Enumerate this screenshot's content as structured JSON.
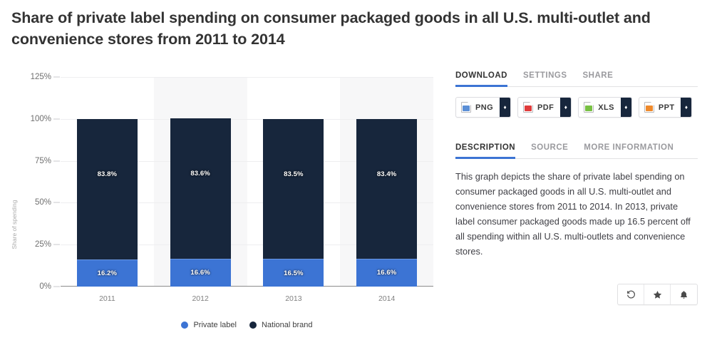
{
  "title": "Share of private label spending on consumer packaged goods in all U.S. multi-outlet and convenience stores from 2011 to 2014",
  "chart_data": {
    "type": "bar",
    "subtype": "stacked-100-percent",
    "title": "Share of private label spending on consumer packaged goods in all U.S. multi-outlet and convenience stores from 2011 to 2014",
    "xlabel": "",
    "ylabel": "Share of spending",
    "categories": [
      "2011",
      "2012",
      "2013",
      "2014"
    ],
    "series": [
      {
        "name": "Private label",
        "color": "#3c74d4",
        "values": [
          16.2,
          16.6,
          16.5,
          16.6
        ],
        "labels": [
          "16.2%",
          "16.6%",
          "16.5%",
          "16.6%"
        ]
      },
      {
        "name": "National brand",
        "color": "#17263c",
        "values": [
          83.8,
          83.6,
          83.5,
          83.4
        ],
        "labels": [
          "83.8%",
          "83.6%",
          "83.5%",
          "83.4%"
        ]
      }
    ],
    "ylim": [
      0,
      125
    ],
    "ytick_labels": [
      "0%",
      "25%",
      "50%",
      "75%",
      "100%",
      "125%"
    ],
    "ytick_values": [
      0,
      25,
      50,
      75,
      100,
      125
    ],
    "grid": true,
    "legend_position": "bottom"
  },
  "panel": {
    "action_tabs": [
      {
        "label": "DOWNLOAD",
        "active": true
      },
      {
        "label": "SETTINGS",
        "active": false
      },
      {
        "label": "SHARE",
        "active": false
      }
    ],
    "downloads": [
      {
        "label": "PNG",
        "icon": "png-file-icon",
        "caret": "♦"
      },
      {
        "label": "PDF",
        "icon": "pdf-file-icon",
        "caret": "♦"
      },
      {
        "label": "XLS",
        "icon": "xls-file-icon",
        "caret": "♦"
      },
      {
        "label": "PPT",
        "icon": "ppt-file-icon",
        "caret": "♦"
      }
    ],
    "info_tabs": [
      {
        "label": "DESCRIPTION",
        "active": true
      },
      {
        "label": "SOURCE",
        "active": false
      },
      {
        "label": "MORE INFORMATION",
        "active": false
      }
    ],
    "description": "This graph depicts the share of private label spending on consumer packaged goods in all U.S. multi-outlet and convenience stores from 2011 to 2014. In 2013, private label consumer packaged goods made up 16.5 percent off all spending within all U.S. multi-outlets and convenience stores.",
    "actions": [
      {
        "name": "history-icon"
      },
      {
        "name": "star-icon"
      },
      {
        "name": "bell-icon"
      }
    ]
  },
  "colors": {
    "private_label": "#3c74d4",
    "national_brand": "#17263c",
    "accent": "#3c74d4"
  }
}
